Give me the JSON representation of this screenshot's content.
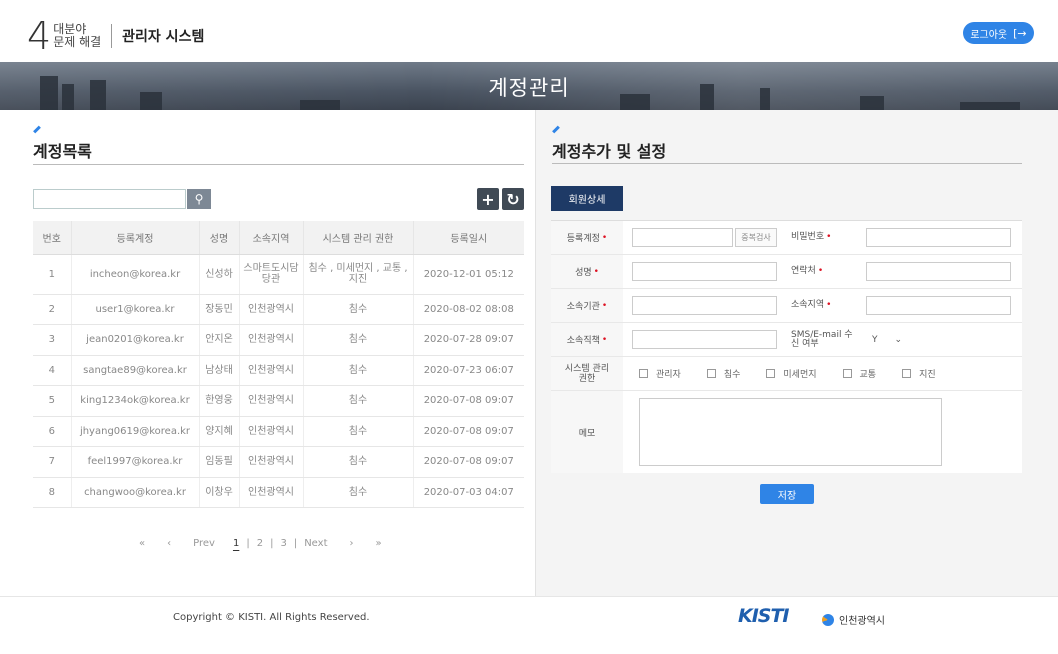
{
  "header": {
    "logo_number": "4",
    "logo_line1": "대분야",
    "logo_line2": "문제 해결",
    "system_title": "관리자 시스템",
    "logout_label": "로그아웃",
    "logout_icon": "logout-icon"
  },
  "banner": {
    "title": "계정관리"
  },
  "account_list": {
    "title": "계정목록",
    "search": {
      "value": "",
      "placeholder": ""
    },
    "columns": [
      "번호",
      "등록계정",
      "성명",
      "소속지역",
      "시스템 관리 권한",
      "등록일시"
    ],
    "rows": [
      {
        "no": "1",
        "account": "incheon@korea.kr",
        "name": "신성하",
        "region": "스마트도시담당관",
        "role": "침수 , 미세먼지 , 교통 , 지진",
        "date": "2020-12-01 05:12"
      },
      {
        "no": "2",
        "account": "user1@korea.kr",
        "name": "장동민",
        "region": "인천광역시",
        "role": "침수",
        "date": "2020-08-02 08:08"
      },
      {
        "no": "3",
        "account": "jean0201@korea.kr",
        "name": "안지온",
        "region": "인천광역시",
        "role": "침수",
        "date": "2020-07-28 09:07"
      },
      {
        "no": "4",
        "account": "sangtae89@korea.kr",
        "name": "남상태",
        "region": "인천광역시",
        "role": "침수",
        "date": "2020-07-23 06:07"
      },
      {
        "no": "5",
        "account": "king1234ok@korea.kr",
        "name": "한영웅",
        "region": "인천광역시",
        "role": "침수",
        "date": "2020-07-08 09:07"
      },
      {
        "no": "6",
        "account": "jhyang0619@korea.kr",
        "name": "양지혜",
        "region": "인천광역시",
        "role": "침수",
        "date": "2020-07-08 09:07"
      },
      {
        "no": "7",
        "account": "feel1997@korea.kr",
        "name": "임동필",
        "region": "인천광역시",
        "role": "침수",
        "date": "2020-07-08 09:07"
      },
      {
        "no": "8",
        "account": "changwoo@korea.kr",
        "name": "이창우",
        "region": "인천광역시",
        "role": "침수",
        "date": "2020-07-03 04:07"
      }
    ],
    "pager": {
      "first": "«",
      "prev_arrow": "‹",
      "prev": "Prev",
      "pages": [
        "1",
        "2",
        "3"
      ],
      "current": "1",
      "next": "Next",
      "next_arrow": "›",
      "last": "»"
    }
  },
  "account_form": {
    "title": "계정추가 및 설정",
    "tab_label": "회원상세",
    "labels": {
      "account": "등록계정",
      "password": "비밀번호",
      "name": "성명",
      "contact": "연락처",
      "org": "소속기관",
      "region": "소속지역",
      "position": "소속직책",
      "sms": "SMS/E-mail 수신 여부",
      "role": "시스템 관리 권한",
      "memo": "메모"
    },
    "dup_check_label": "중복검사",
    "sms_value": "Y",
    "roles": [
      "관리자",
      "침수",
      "미세먼지",
      "교통",
      "지진"
    ],
    "save_label": "저장"
  },
  "footer": {
    "copyright": "Copyright © KISTI. All Rights Reserved.",
    "kisti_logo": "KISTI",
    "incheon_logo": "인천광역시"
  }
}
